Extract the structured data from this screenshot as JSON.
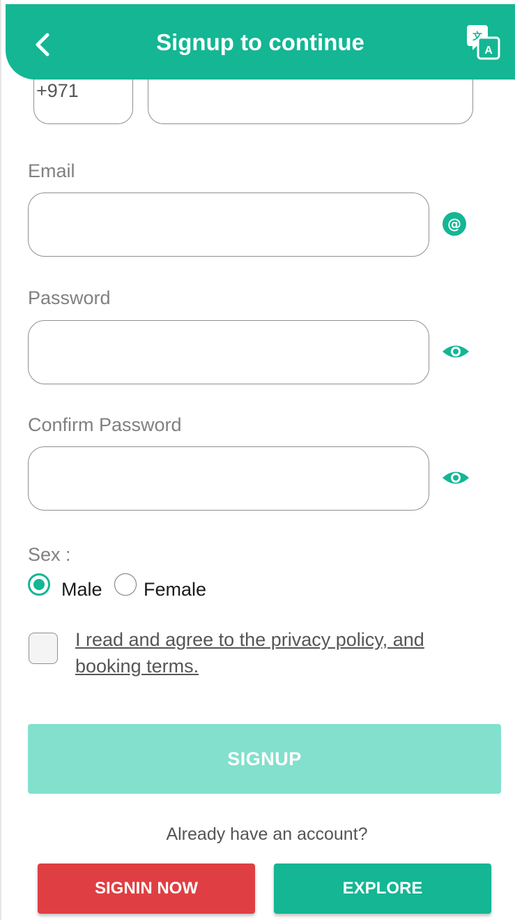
{
  "colors": {
    "primary": "#14b694",
    "signup_disabled": "#82e0cd",
    "signin": "#df3f42",
    "label_gray": "#808080"
  },
  "header": {
    "title": "Signup to continue",
    "back_icon": "chevron-left-icon",
    "translate_icon": "translate-icon"
  },
  "phone": {
    "country_code": "+971",
    "number_value": ""
  },
  "email": {
    "label": "Email",
    "value": "",
    "icon": "at-sign-icon"
  },
  "password": {
    "label": "Password",
    "value": "",
    "icon": "eye-icon"
  },
  "confirm_password": {
    "label": "Confirm Password",
    "value": "",
    "icon": "eye-icon"
  },
  "sex": {
    "label": "Sex :",
    "options": [
      "Male",
      "Female"
    ],
    "selected": "Male"
  },
  "terms": {
    "text": "I read and agree to the privacy policy, and booking terms.",
    "checked": false
  },
  "signup_button": {
    "label": "SIGNUP"
  },
  "already_account": {
    "text": "Already have an account?"
  },
  "signin_button": {
    "label": "SIGNIN NOW"
  },
  "explore_button": {
    "label": "EXPLORE"
  }
}
